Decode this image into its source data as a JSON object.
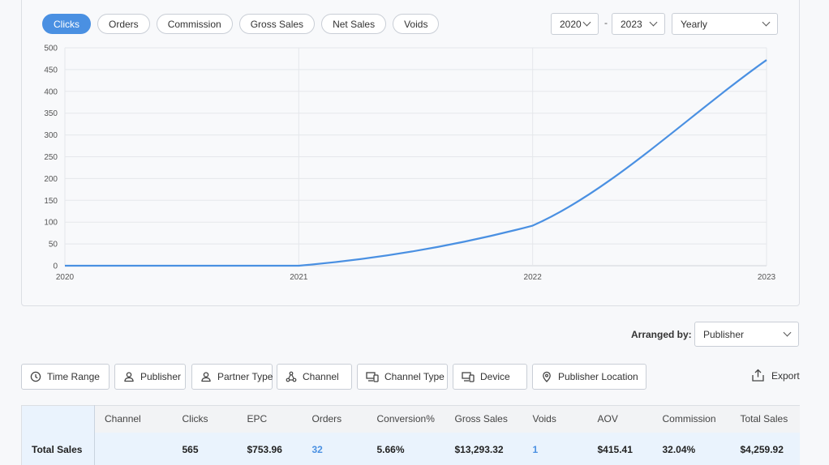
{
  "metric_tabs": [
    "Clicks",
    "Orders",
    "Commission",
    "Gross Sales",
    "Net Sales",
    "Voids"
  ],
  "active_metric": "Clicks",
  "range": {
    "from": "2020",
    "separator": "-",
    "to": "2023",
    "granularity": "Yearly"
  },
  "colors": {
    "accent": "#4a90e2",
    "grid": "#e5e7eb"
  },
  "chart_data": {
    "type": "line",
    "x": [
      "2020",
      "2021",
      "2022",
      "2023"
    ],
    "series": [
      {
        "values": [
          0,
          0,
          92,
          472
        ]
      }
    ],
    "ylim": [
      0,
      500
    ],
    "yticks": [
      "0",
      "50",
      "100",
      "150",
      "200",
      "250",
      "300",
      "350",
      "400",
      "450",
      "500"
    ],
    "grid": true
  },
  "arranged_by": {
    "label": "Arranged by:",
    "value": "Publisher"
  },
  "dimensions": [
    {
      "label": "Time Range",
      "icon": "clock-icon"
    },
    {
      "label": "Publisher",
      "icon": "user-icon"
    },
    {
      "label": "Partner Type",
      "icon": "user-icon"
    },
    {
      "label": "Channel",
      "icon": "network-icon"
    },
    {
      "label": "Channel Type",
      "icon": "devices-icon"
    },
    {
      "label": "Device",
      "icon": "devices-icon"
    },
    {
      "label": "Publisher Location",
      "icon": "location-pin-icon"
    }
  ],
  "export_label": "Export",
  "table": {
    "headers": [
      "",
      "Channel",
      "Clicks",
      "EPC",
      "Orders",
      "Conversion%",
      "Gross Sales",
      "Voids",
      "AOV",
      "Commission",
      "Total Sales"
    ],
    "total_row": [
      "Total Sales",
      "",
      "565",
      "$753.96",
      "32",
      "5.66%",
      "$13,293.32",
      "1",
      "$415.41",
      "32.04%",
      "$4,259.92"
    ]
  }
}
